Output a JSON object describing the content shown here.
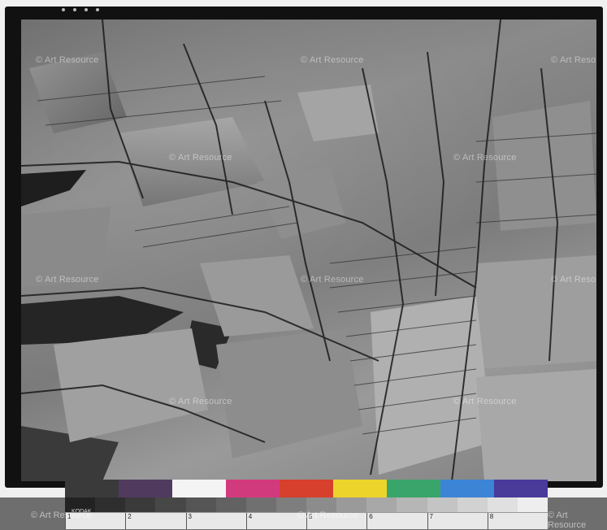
{
  "watermarks": {
    "text": "© Art Resource"
  },
  "color_patches": [
    "#3a3a3a",
    "#503a5e",
    "#f4f4f4",
    "#d23a7e",
    "#d6402c",
    "#ecd42a",
    "#3aa56a",
    "#3c84d6",
    "#4a3a9a"
  ],
  "gray_patches": [
    "#222",
    "#2e2e2e",
    "#3a3a3a",
    "#474747",
    "#555",
    "#626262",
    "#707070",
    "#7e7e7e",
    "#8c8c8c",
    "#9a9a9a",
    "#a8a8a8",
    "#b6b6b6",
    "#c4c4c4",
    "#d2d2d2",
    "#e0e0e0",
    "#eeeeee"
  ],
  "ruler_marks": [
    "1",
    "2",
    "3",
    "4",
    "5",
    "6",
    "7",
    "8"
  ],
  "kodak_label": "KODAK"
}
